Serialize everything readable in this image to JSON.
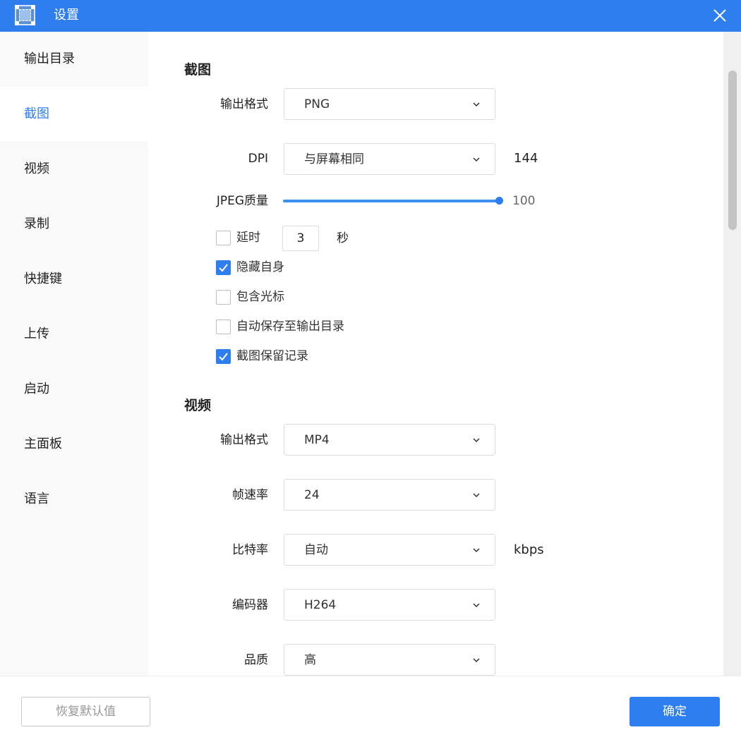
{
  "window": {
    "title": "设置",
    "app_icon": "screenshot-app-icon",
    "close_icon": "close-icon"
  },
  "sidebar": {
    "items": [
      {
        "label": "输出目录",
        "active": false
      },
      {
        "label": "截图",
        "active": true
      },
      {
        "label": "视频",
        "active": false
      },
      {
        "label": "录制",
        "active": false
      },
      {
        "label": "快捷键",
        "active": false
      },
      {
        "label": "上传",
        "active": false
      },
      {
        "label": "启动",
        "active": false
      },
      {
        "label": "主面板",
        "active": false
      },
      {
        "label": "语言",
        "active": false
      }
    ]
  },
  "screenshot": {
    "title": "截图",
    "output_format": {
      "label": "输出格式",
      "value": "PNG"
    },
    "dpi": {
      "label": "DPI",
      "value": "与屏幕相同",
      "readout": "144"
    },
    "jpeg_quality": {
      "label": "JPEG质量",
      "value": 100,
      "min": 0,
      "max": 100,
      "display": "100"
    },
    "delay": {
      "label": "延时",
      "checked": false,
      "value": "3",
      "unit": "秒"
    },
    "options": [
      {
        "label": "隐藏自身",
        "checked": true
      },
      {
        "label": "包含光标",
        "checked": false
      },
      {
        "label": "自动保存至输出目录",
        "checked": false
      },
      {
        "label": "截图保留记录",
        "checked": true
      }
    ]
  },
  "video": {
    "title": "视频",
    "output_format": {
      "label": "输出格式",
      "value": "MP4"
    },
    "frame_rate": {
      "label": "帧速率",
      "value": "24"
    },
    "bitrate": {
      "label": "比特率",
      "value": "自动",
      "unit": "kbps"
    },
    "encoder": {
      "label": "编码器",
      "value": "H264"
    },
    "quality": {
      "label": "品质",
      "value": "高"
    }
  },
  "footer": {
    "reset_label": "恢复默认值",
    "ok_label": "确定"
  },
  "colors": {
    "accent": "#2f7ef0",
    "sidebar_bg": "#f9f9f9"
  }
}
